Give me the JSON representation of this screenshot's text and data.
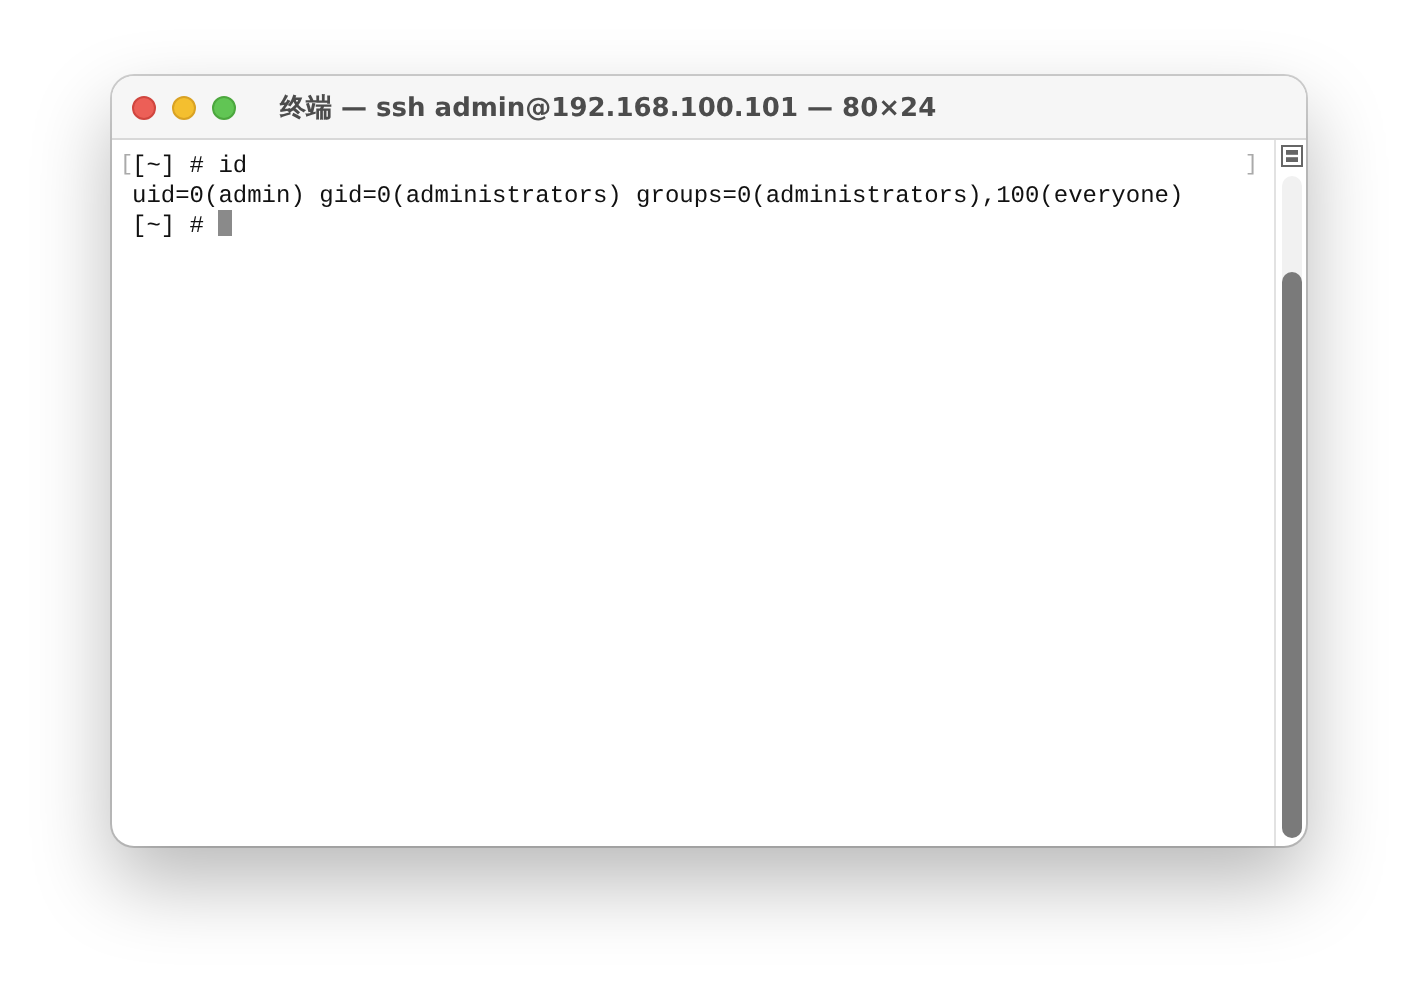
{
  "window": {
    "title": "终端 — ssh admin@192.168.100.101 — 80×24"
  },
  "terminal": {
    "mark_open": "[",
    "mark_close": "]",
    "lines": [
      {
        "kind": "text",
        "text": "[~] # id"
      },
      {
        "kind": "text",
        "text": "uid=0(admin) gid=0(administrators) groups=0(administrators),100(everyone)"
      },
      {
        "kind": "prompt",
        "text": "[~] # "
      }
    ]
  }
}
